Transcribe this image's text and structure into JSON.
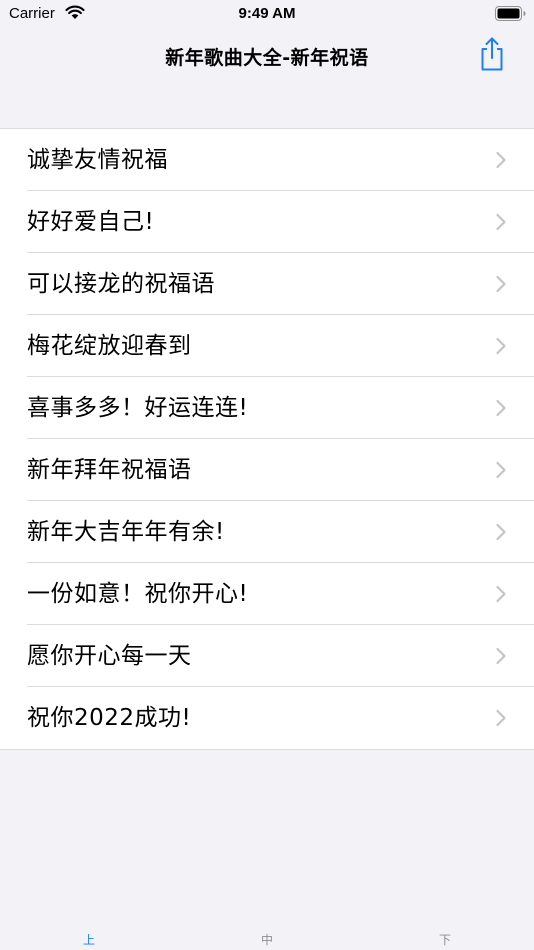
{
  "status_bar": {
    "carrier": "Carrier",
    "time": "9:49 AM",
    "wifi_icon": "wifi-icon",
    "battery_icon": "battery-icon"
  },
  "nav": {
    "title": "新年歌曲大全-新年祝语",
    "share_icon": "share-icon",
    "accent_color": "#1f7ff2"
  },
  "list": {
    "items": [
      {
        "label": "诚挚友情祝福"
      },
      {
        "label": "好好爱自己!"
      },
      {
        "label": "可以接龙的祝福语"
      },
      {
        "label": "梅花绽放迎春到"
      },
      {
        "label": "喜事多多！好运连连!"
      },
      {
        "label": "新年拜年祝福语"
      },
      {
        "label": "新年大吉年年有余!"
      },
      {
        "label": "一份如意！祝你开心!"
      },
      {
        "label": "愿你开心每一天"
      },
      {
        "label": "祝你2022成功!"
      }
    ],
    "chevron_icon": "chevron-right-icon"
  },
  "tabs": [
    {
      "label": "上",
      "active": true
    },
    {
      "label": "中",
      "active": false
    },
    {
      "label": "下",
      "active": false
    }
  ]
}
